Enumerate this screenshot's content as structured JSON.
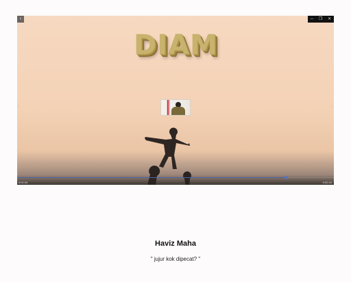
{
  "player": {
    "back_glyph": "‹",
    "window_controls": {
      "minimize": "─",
      "maximize": "❐",
      "close": "✕"
    },
    "title_art_text": "DIAM",
    "prev_glyph": "‹",
    "next_glyph": "›",
    "time_current": "0:01:04",
    "time_duration": "0:02:16",
    "progress_fraction": 0.85,
    "accent_color": "#4b63ad"
  },
  "caption": {
    "author": "Haviz Maha",
    "quote": "\" jujur kok dipecat? \""
  }
}
